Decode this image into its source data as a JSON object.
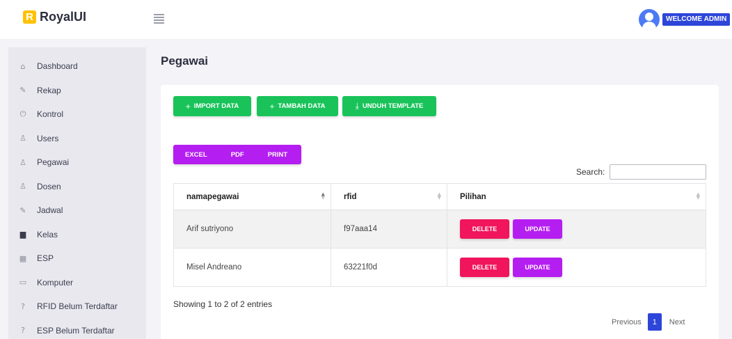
{
  "brand": {
    "logo_letter": "R",
    "name": "RoyalUI"
  },
  "header": {
    "welcome": "WELCOME ADMIN"
  },
  "sidebar": {
    "items": [
      {
        "label": "Dashboard",
        "icon": "⌂"
      },
      {
        "label": "Rekap",
        "icon": "✎"
      },
      {
        "label": "Kontrol",
        "icon": "⏻"
      },
      {
        "label": "Users",
        "icon": "♙"
      },
      {
        "label": "Pegawai",
        "icon": "♙"
      },
      {
        "label": "Dosen",
        "icon": "♙"
      },
      {
        "label": "Jadwal",
        "icon": "✎"
      },
      {
        "label": "Kelas",
        "icon": "▆"
      },
      {
        "label": "ESP",
        "icon": "▦"
      },
      {
        "label": "Komputer",
        "icon": "▭"
      },
      {
        "label": "RFID Belum Terdaftar",
        "icon": "?"
      },
      {
        "label": "ESP Belum Terdaftar",
        "icon": "?"
      }
    ]
  },
  "main": {
    "title": "Pegawai",
    "buttons": {
      "import": "IMPORT DATA",
      "tambah": "TAMBAH DATA",
      "unduh": "UNDUH TEMPLATE",
      "plus_glyph": "+",
      "download_glyph": "⤓"
    },
    "export": {
      "excel": "EXCEL",
      "pdf": "PDF",
      "print": "PRINT"
    },
    "search_label": "Search:",
    "table": {
      "columns": [
        "namapegawai",
        "rfid",
        "Pilihan"
      ],
      "rows": [
        {
          "nama": "Arif sutriyono",
          "rfid": "f97aaa14"
        },
        {
          "nama": "Misel Andreano",
          "rfid": "63221f0d"
        }
      ],
      "delete_label": "DELETE",
      "update_label": "UPDATE"
    },
    "showing": "Showing 1 to 2 of 2 entries",
    "pagination": {
      "previous": "Previous",
      "current": "1",
      "next": "Next"
    }
  },
  "colors": {
    "green": "#19c35a",
    "purple": "#b51ef0",
    "red": "#f0155c",
    "blue": "#2d45d9"
  }
}
